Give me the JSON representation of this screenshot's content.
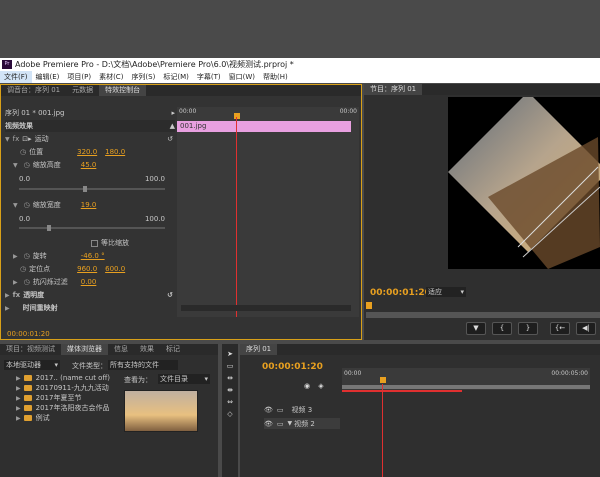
{
  "window": {
    "title": "Adobe Premiere Pro - D:\\文档\\Adobe\\Premiere Pro\\6.0\\视频测试.prproj *",
    "logo": "Pr"
  },
  "menu": [
    "文件(F)",
    "编辑(E)",
    "项目(P)",
    "素材(C)",
    "序列(S)",
    "标记(M)",
    "字幕(T)",
    "窗口(W)",
    "帮助(H)"
  ],
  "top_tabs": [
    "调音台：序列 01",
    "元数据",
    "特效控制台"
  ],
  "monitor_tab": "节目：序列 01",
  "effects": {
    "clip_label": "序列 01 * 001.jpg",
    "clip_name": "001.jpg",
    "ruler_start": "00:00",
    "ruler_end": "00:00",
    "video_effects_label": "视频效果",
    "motion": "运动",
    "position_label": "位置",
    "position_x": "320.0",
    "position_y": "180.0",
    "scale_h_label": "缩放高度",
    "scale_h": "45.0",
    "scale_w_label": "缩放宽度",
    "scale_w": "19.0",
    "range_min": "0.0",
    "range_max": "100.0",
    "uniform_scale": "等比缩放",
    "rotation_label": "旋转",
    "rotation": "-46.0 °",
    "anchor_label": "定位点",
    "anchor_x": "960.0",
    "anchor_y": "600.0",
    "flicker_label": "抗闪烁过滤",
    "flicker": "0.00",
    "opacity": "透明度",
    "time_remap": "时间重映射",
    "timecode": "00:00:01:20"
  },
  "monitor": {
    "timecode": "00:00:01:20",
    "fit_option": "适应"
  },
  "transport_buttons": [
    "▼",
    "{",
    "}",
    "{←",
    "◀|"
  ],
  "project": {
    "tabs": [
      "项目：视频测试",
      "媒体浏览器",
      "信息",
      "效果",
      "标记"
    ],
    "location": "本地驱动器",
    "file_type_label": "文件类型：",
    "file_type_value": "所有支持的文件",
    "view_as_label": "查看为：",
    "view_as_value": "文件目录",
    "folders": [
      "2017.. (name cut off)",
      "20170911-九九九活动",
      "2017年夏至节",
      "2017年洛阳夜古会作品",
      "例试"
    ]
  },
  "timeline": {
    "tab": "序列 01",
    "timecode": "00:00:01:20",
    "ruler_start": "00:00",
    "ruler_end": "00:00:05:00",
    "tracks": [
      "视频 3",
      "视频 2"
    ]
  },
  "colors": {
    "clip_pink": "#e8a0e0",
    "timecode_orange": "#e8a020",
    "playhead_red": "#e03030",
    "panel_dark": "#333333"
  }
}
